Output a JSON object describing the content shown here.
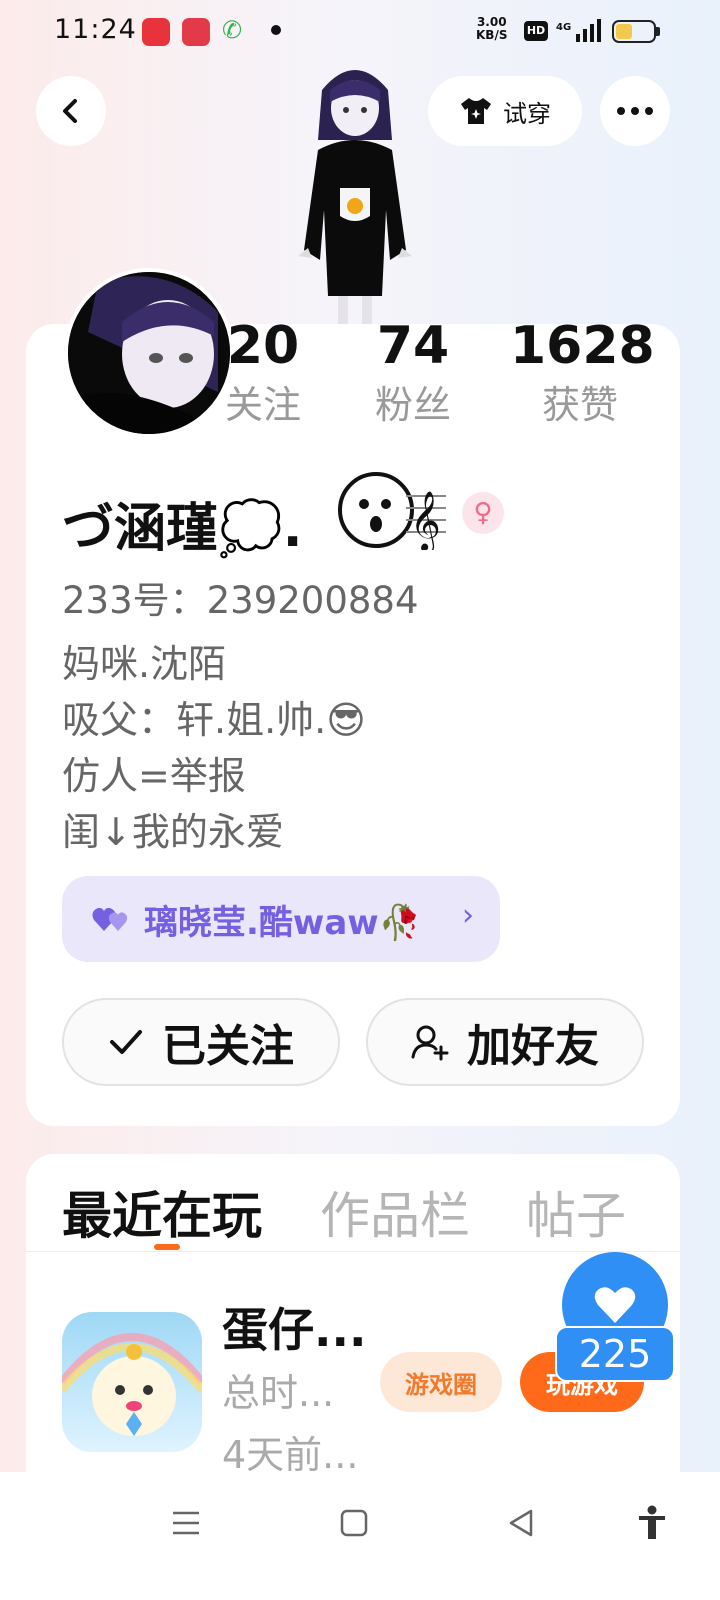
{
  "status_bar": {
    "time": "11:24",
    "net_speed_value": "3.00",
    "net_speed_unit": "KB/S",
    "hd_label": "HD",
    "network_label": "4G",
    "icons": [
      "xiaohongshu-app-icon",
      "app-icon",
      "phone-call-icon",
      "notification-dot",
      "signal-icon",
      "battery-icon"
    ]
  },
  "header": {
    "back_icon": "chevron-left-icon",
    "tryon_icon": "tshirt-icon",
    "tryon_label": "试穿",
    "more_icon": "more-dots-icon"
  },
  "profile": {
    "stats": [
      {
        "value": "20",
        "label": "关注"
      },
      {
        "value": "74",
        "label": "粉丝"
      },
      {
        "value": "1628",
        "label": "获赞"
      }
    ],
    "nickname": "づ涵瑾💭.",
    "gender_icon": "female-icon",
    "uid": "233号：239200884",
    "bio_lines": [
      "妈咪.沈陌",
      "吸父：轩.姐.帅.😎",
      "仿人=举报",
      "闺↓我的永爱"
    ],
    "cp": {
      "icon": "double-heart-icon",
      "name": "璃晓莹.酷waw🥀",
      "chevron": "chevron-right-icon"
    },
    "buttons": {
      "follow_label": "已关注",
      "add_friend_label": "加好友"
    }
  },
  "tabs": [
    {
      "label": "最近在玩",
      "active": true
    },
    {
      "label": "作品栏",
      "active": false
    },
    {
      "label": "帖子",
      "active": false
    }
  ],
  "game": {
    "name": "蛋仔...",
    "total_time": "总时...",
    "last_played": "4天前...",
    "circle_label": "游戏圈",
    "play_label": "玩游戏"
  },
  "like": {
    "icon": "heart-icon",
    "count": "225"
  },
  "nav": {
    "icons": [
      "menu-icon",
      "home-square-icon",
      "back-triangle-icon",
      "accessibility-icon"
    ]
  },
  "colors": {
    "accent_orange": "#ff6a1a",
    "cp_purple": "#7560e0",
    "like_blue": "#2f8ff5"
  }
}
